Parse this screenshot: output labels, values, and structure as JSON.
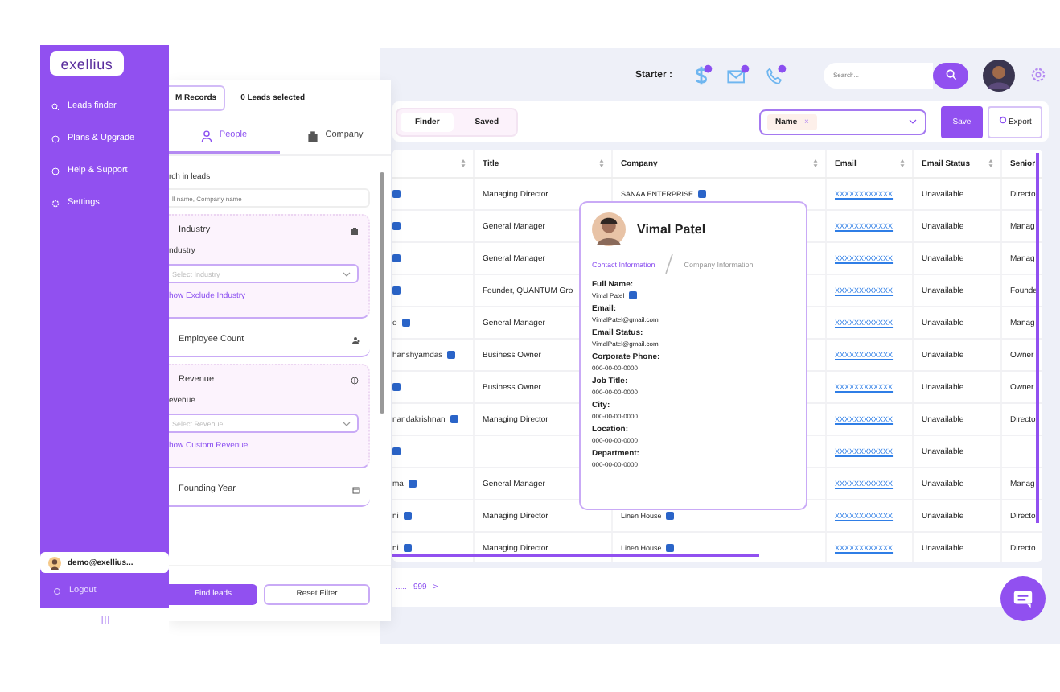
{
  "sidebar": {
    "logo": "exellius",
    "items": [
      {
        "label": "Leads finder",
        "kind": "search"
      },
      {
        "label": "Plans & Upgrade",
        "kind": "plan"
      },
      {
        "label": "Help & Support",
        "kind": "help"
      },
      {
        "label": "Settings",
        "kind": "settings"
      }
    ],
    "user": "demo@exellius...",
    "logout": "Logout"
  },
  "filter_panel": {
    "record_tabs": [
      {
        "label": "M Records",
        "selected": true
      },
      {
        "label": "0 Leads selected",
        "selected": false
      }
    ],
    "tabs": [
      {
        "label": "People",
        "kind": "person",
        "selected": true
      },
      {
        "label": "Company",
        "kind": "building",
        "selected": false
      }
    ],
    "search_label": "rch in leads",
    "search_placeholder": "ll name, Company name",
    "sections": [
      {
        "title": "Industry",
        "kind": "building",
        "expanded": true,
        "field_label": "ndustry",
        "placeholder": "Select Industry",
        "link": "how Exclude Industry"
      },
      {
        "title": "Employee Count",
        "kind": "people",
        "expanded": false
      },
      {
        "title": "Revenue",
        "kind": "money",
        "expanded": true,
        "field_label": "evenue",
        "placeholder": "Select Revenue",
        "link": "how Custom Revenue"
      },
      {
        "title": "Founding Year",
        "kind": "calendar",
        "expanded": false
      }
    ],
    "buttons": [
      "Find leads",
      "Reset Filter"
    ]
  },
  "top_bar": {
    "plan_label": "Starter :",
    "search_placeholder": "Search..."
  },
  "toolbar": {
    "views": [
      {
        "label": "Finder",
        "selected": true
      },
      {
        "label": "Saved",
        "selected": false
      }
    ],
    "column_chip": "Name",
    "chip_remove": "×",
    "save": "Save",
    "export": "Export"
  },
  "table": {
    "columns": [
      "Title",
      "Company",
      "Email",
      "Email Status",
      "Senior"
    ],
    "rows": [
      {
        "linkedin": true,
        "title": "Managing Director",
        "company": "SANAA ENTERPRISE",
        "email": "XXXXXXXXXXXX",
        "email_status": "Unavailable",
        "senior": "Directo"
      },
      {
        "linkedin": true,
        "title": "General Manager",
        "email": "XXXXXXXXXXXX",
        "email_status": "Unavailable",
        "senior": "Manag"
      },
      {
        "linkedin": true,
        "title": "General Manager",
        "email": "XXXXXXXXXXXX",
        "email_status": "Unavailable",
        "senior": "Manag"
      },
      {
        "linkedin": true,
        "title": "Founder, QUANTUM Gro",
        "email": "XXXXXXXXXXXX",
        "email_status": "Unavailable",
        "senior": "Founde"
      },
      {
        "name": "o",
        "linkedin": true,
        "title": "General Manager",
        "email": "XXXXXXXXXXXX",
        "email_status": "Unavailable",
        "senior": "Manag"
      },
      {
        "name": "hanshyamdas",
        "linkedin": true,
        "title": "Business Owner",
        "email": "XXXXXXXXXXXX",
        "email_status": "Unavailable",
        "senior": "Owner"
      },
      {
        "linkedin": true,
        "title": "Business Owner",
        "email": "XXXXXXXXXXXX",
        "email_status": "Unavailable",
        "senior": "Owner"
      },
      {
        "name": "nandakrishnan",
        "linkedin": true,
        "title": "Managing Director",
        "email": "XXXXXXXXXXXX",
        "email_status": "Unavailable",
        "senior": "Directo"
      },
      {
        "linkedin": true,
        "email": "XXXXXXXXXXXX",
        "email_status": "Unavailable"
      },
      {
        "name": "ma",
        "linkedin": true,
        "title": "General Manager",
        "email": "XXXXXXXXXXXX",
        "email_status": "Unavailable",
        "senior": "Manag"
      },
      {
        "name": "ni",
        "linkedin": true,
        "title": "Managing Director",
        "company": "Linen House",
        "email": "XXXXXXXXXXXX",
        "email_status": "Unavailable",
        "senior": "Directo"
      },
      {
        "name": "ni",
        "linkedin": true,
        "title": "Managing Director",
        "company": "Linen House",
        "email": "XXXXXXXXXXXX",
        "email_status": "Unavailable",
        "senior": "Directo"
      }
    ]
  },
  "pagination": {
    "ellipsis": ".....",
    "last": "999",
    "next": ">"
  },
  "contact_card": {
    "name": "Vimal Patel",
    "tabs": [
      {
        "label": "Contact Information",
        "selected": true
      },
      {
        "label": "Company Information",
        "selected": false
      }
    ],
    "fields": [
      {
        "label": "Full Name:",
        "value": "Vimal Patel",
        "linkedin": true
      },
      {
        "label": "Email:",
        "value": "VimalPatel@gmail.com",
        "linkedin": false
      },
      {
        "label": "Email Status:",
        "value": "VimalPatel@gmail.com",
        "linkedin": false
      },
      {
        "label": "Corporate Phone:",
        "value": "000-00-00-0000",
        "linkedin": false
      },
      {
        "label": "Job Title:",
        "value": "000-00-00-0000",
        "linkedin": false
      },
      {
        "label": "City:",
        "value": "000-00-00-0000",
        "linkedin": false
      },
      {
        "label": "Location:",
        "value": "000-00-00-0000",
        "linkedin": false
      },
      {
        "label": "Department:",
        "value": "000-00-00-0000",
        "linkedin": false
      }
    ]
  }
}
